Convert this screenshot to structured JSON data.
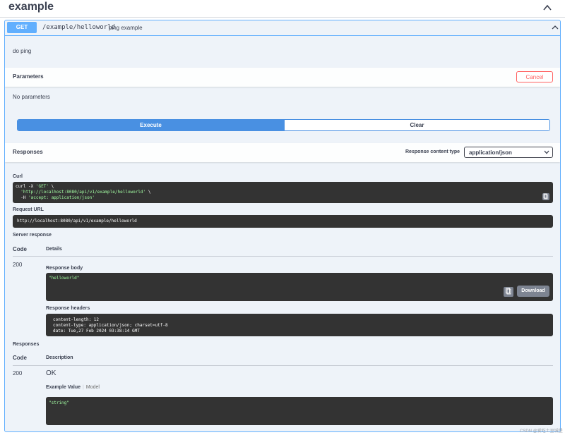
{
  "tag": {
    "title": "example"
  },
  "operation": {
    "method": "GET",
    "path": "/example/helloworld",
    "summary": "ping example",
    "description": "do ping"
  },
  "parameters": {
    "title": "Parameters",
    "cancel_label": "Cancel",
    "empty_text": "No parameters"
  },
  "actions": {
    "execute_label": "Execute",
    "clear_label": "Clear"
  },
  "responses_section": {
    "title": "Responses",
    "content_type_label": "Response content type",
    "content_type_value": "application/json"
  },
  "curl": {
    "label": "Curl",
    "line1_cmd": "curl -X ",
    "line1_method": "'GET'",
    "line1_tail": " \\",
    "line2_url": "  'http://localhost:8080/api/v1/example/helloworld'",
    "line2_tail": " \\",
    "line3_flag": "  -H ",
    "line3_header": "'accept: application/json'"
  },
  "request_url": {
    "label": "Request URL",
    "value": "http://localhost:8080/api/v1/example/helloworld"
  },
  "server_response": {
    "label": "Server response",
    "col_code": "Code",
    "col_details": "Details",
    "code": "200",
    "body_label": "Response body",
    "body_value": "\"helloworld\"",
    "download_label": "Download",
    "headers_label": "Response headers",
    "headers": [
      "content-length: 12",
      "content-type: application/json; charset=utf-8",
      "date: Tue,27 Feb 2024 03:38:14 GMT"
    ]
  },
  "documented_responses": {
    "label": "Responses",
    "col_code": "Code",
    "col_description": "Description",
    "code": "200",
    "description": "OK",
    "tab_example": "Example Value",
    "tab_model": "Model",
    "example_value": "\"string\""
  },
  "watermark": "CSDN @爱吃土豆城堡",
  "colors": {
    "get_blue": "#61affe",
    "execute_blue": "#4990e2",
    "cancel_red": "#ff6060",
    "code_bg": "#333333",
    "string_green": "#a2fca2"
  }
}
